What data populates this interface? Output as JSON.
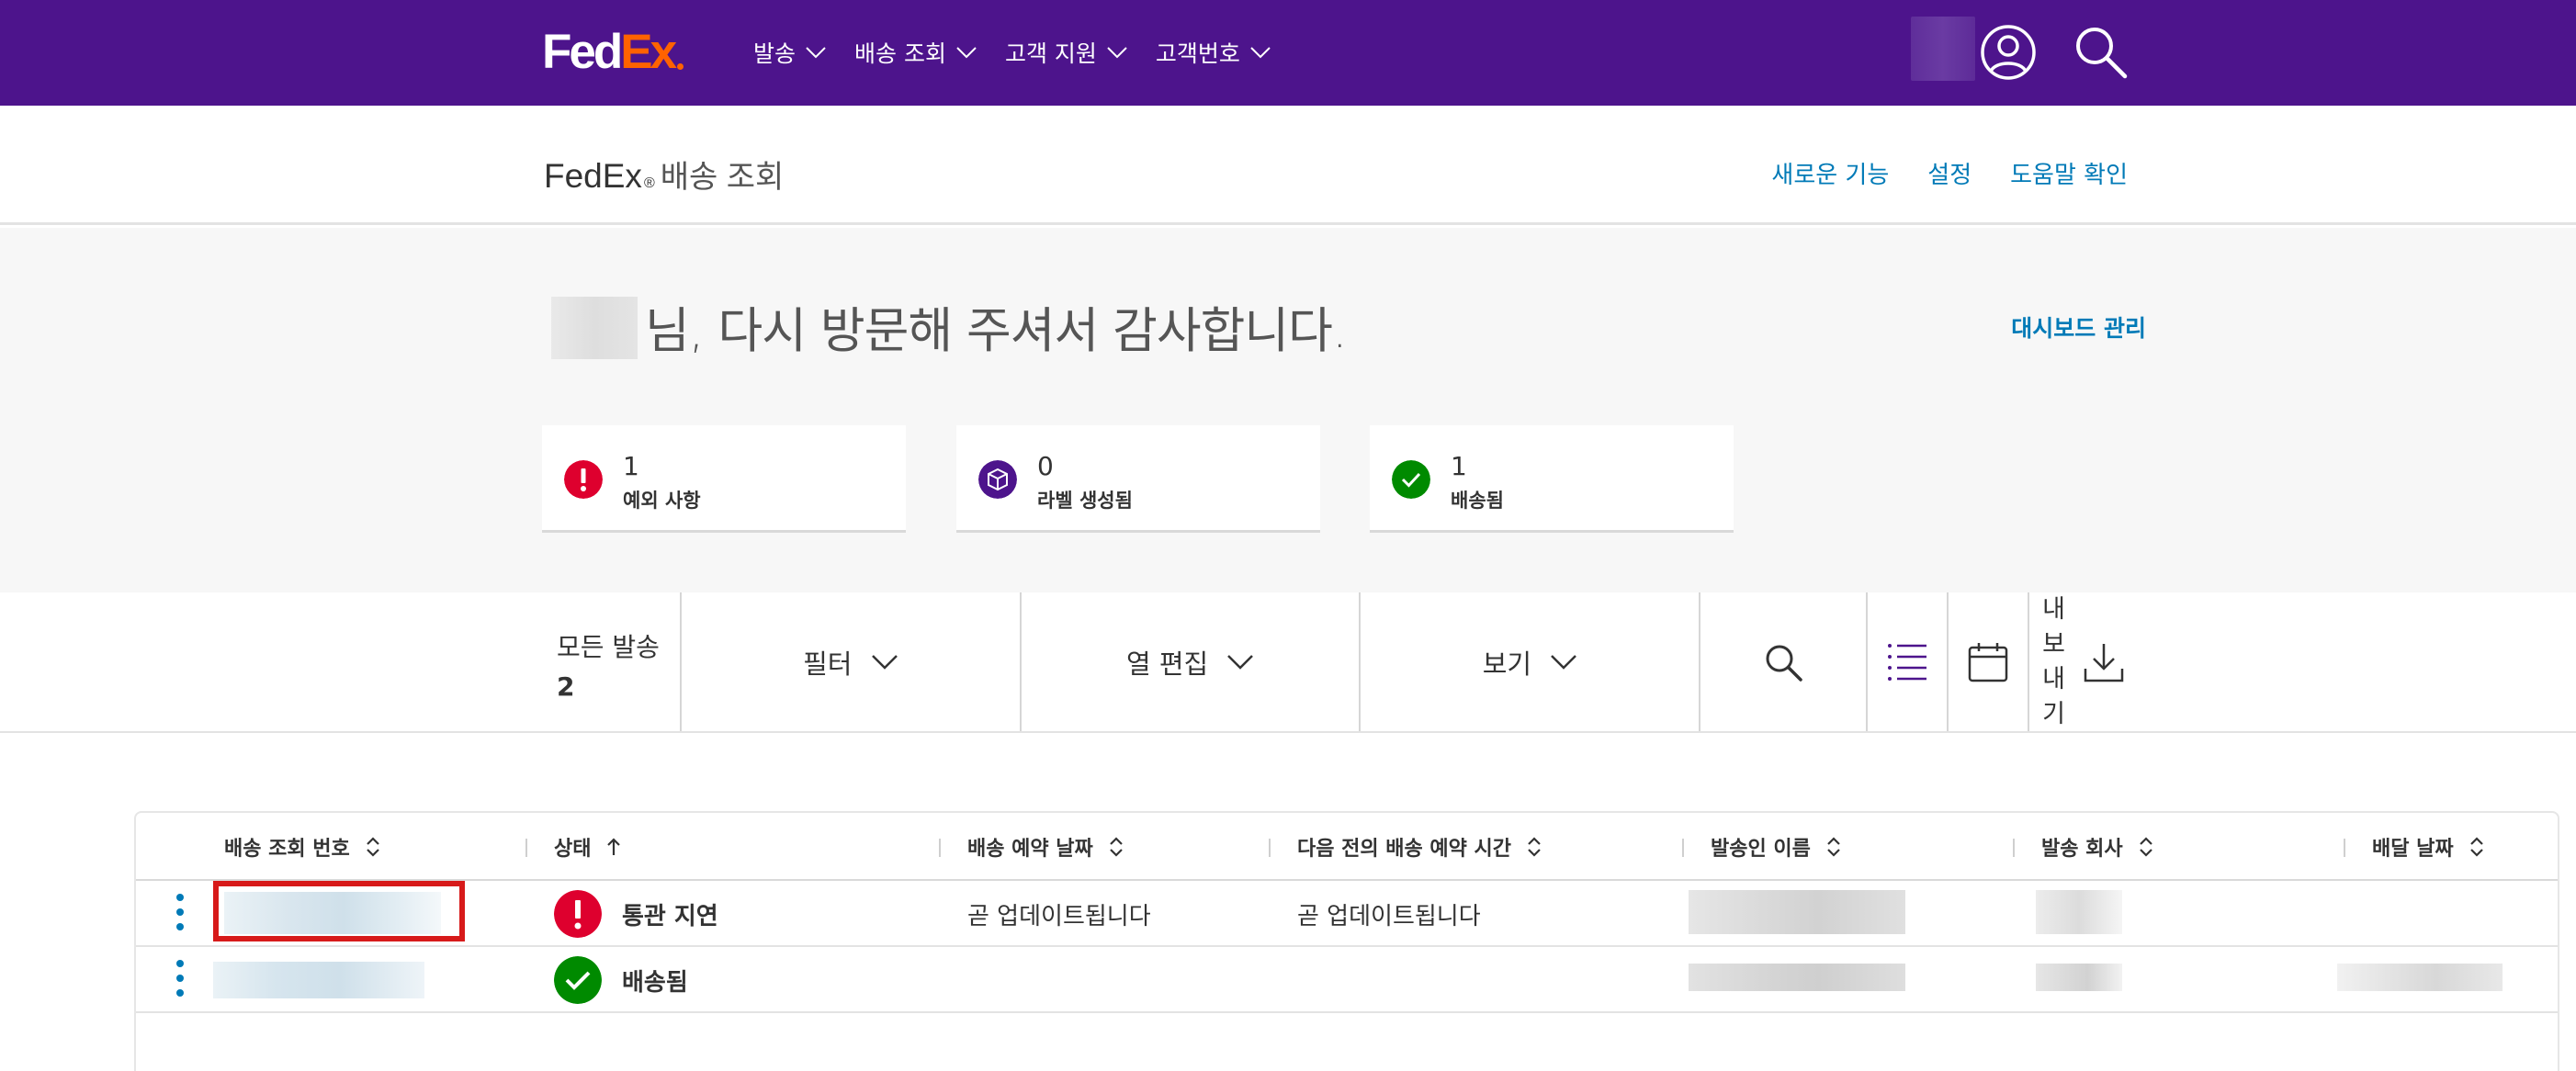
{
  "nav": {
    "logo_left": "Fed",
    "logo_right": "Ex",
    "menu": [
      {
        "label": "발송"
      },
      {
        "label": "배송 조회"
      },
      {
        "label": "고객 지원"
      },
      {
        "label": "고객번호"
      }
    ],
    "icons": {
      "user": "user-circle-icon",
      "search": "search-icon"
    }
  },
  "subheader": {
    "brand": "FedEx",
    "reg": "®",
    "page": "배송 조회",
    "links": [
      "새로운 기능",
      "설정",
      "도움말 확인"
    ]
  },
  "welcome": {
    "text": "님, 다시 방문해 주셔서 감사합니다.",
    "dashboard_link": "대시보드 관리"
  },
  "summary": [
    {
      "count": "1",
      "label": "예외 사항",
      "icon": "exclamation-icon",
      "color": "#de002e"
    },
    {
      "count": "0",
      "label": "라벨 생성됨",
      "icon": "package-icon",
      "color": "#4d148c"
    },
    {
      "count": "1",
      "label": "배송됨",
      "icon": "checkmark-icon",
      "color": "#008a00"
    }
  ],
  "toolbar": {
    "all_label": "모든 발송",
    "all_count": "2",
    "filter": "필터",
    "edit_columns": "열 편집",
    "view": "보기",
    "export_chars": [
      "내",
      "보",
      "내",
      "기"
    ]
  },
  "table": {
    "columns": [
      {
        "label": "배송 조회 번호",
        "sort": "both"
      },
      {
        "label": "상태",
        "sort": "asc"
      },
      {
        "label": "배송 예약 날짜",
        "sort": "both"
      },
      {
        "label": "다음 전의 배송 예약 시간",
        "sort": "both"
      },
      {
        "label": "발송인 이름",
        "sort": "both"
      },
      {
        "label": "발송 회사",
        "sort": "both"
      },
      {
        "label": "배달 날짜",
        "sort": "both"
      }
    ],
    "rows": [
      {
        "status": "통관 지연",
        "status_icon": "exclamation-icon",
        "status_color": "#de002e",
        "scheduled_date": "곧 업데이트됩니다",
        "scheduled_time": "곧 업데이트됩니다"
      },
      {
        "status": "배송됨",
        "status_icon": "checkmark-icon",
        "status_color": "#008a00",
        "scheduled_date": "",
        "scheduled_time": ""
      }
    ]
  },
  "colors": {
    "brand_purple": "#4d148c",
    "brand_orange": "#ff6200",
    "link_blue": "#007ab7",
    "highlight_red": "#d71a1a"
  }
}
